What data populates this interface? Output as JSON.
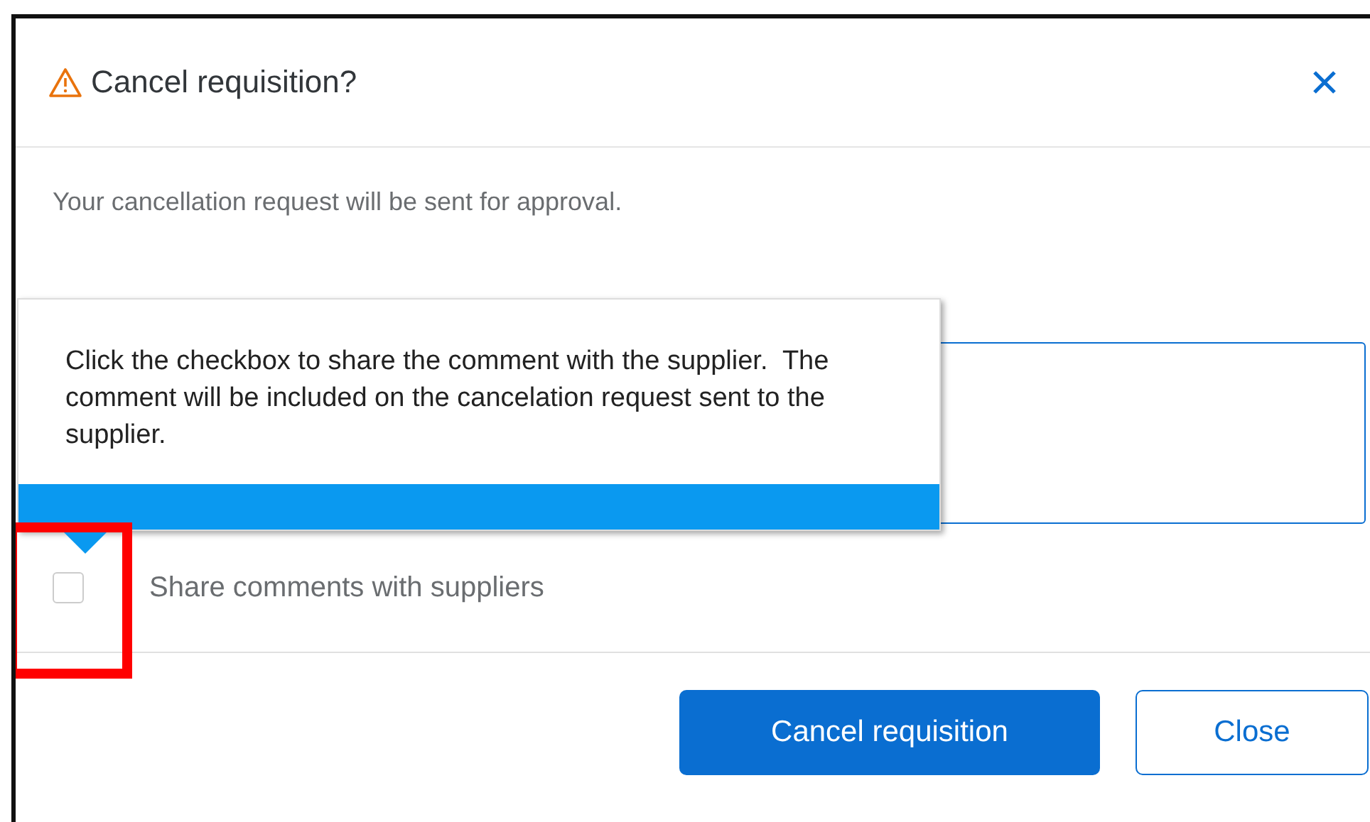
{
  "dialog": {
    "title": "Cancel requisition?",
    "message": "Your cancellation request will be sent for approval.",
    "tooltip": {
      "text": "Click the checkbox to share the comment with the supplier.  The comment will be included on the cancelation request sent to the supplier."
    },
    "share_checkbox": {
      "label": "Share comments with suppliers",
      "checked": false
    },
    "buttons": [
      {
        "label": "Cancel requisition",
        "kind": "primary"
      },
      {
        "label": "Close",
        "kind": "secondary"
      }
    ]
  }
}
